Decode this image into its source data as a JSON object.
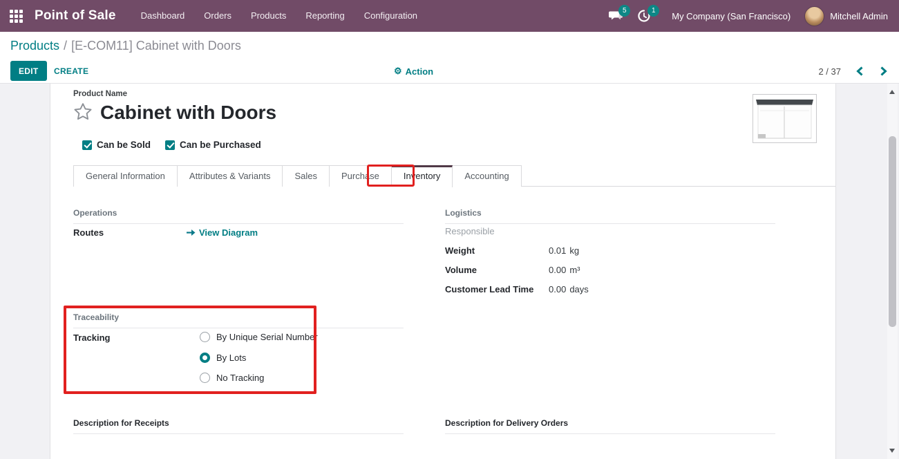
{
  "colors": {
    "navbar_bg": "#714B67",
    "accent_teal": "#017E84",
    "annotation_red": "#E1201F",
    "badge_teal": "#0D8786"
  },
  "navbar": {
    "app_name": "Point of Sale",
    "menus": [
      "Dashboard",
      "Orders",
      "Products",
      "Reporting",
      "Configuration"
    ],
    "messages_badge": "5",
    "activities_badge": "1",
    "company": "My Company (San Francisco)",
    "user": "Mitchell Admin"
  },
  "breadcrumb": {
    "parent": "Products",
    "separator": "/",
    "current": "[E-COM11] Cabinet with Doors"
  },
  "control_panel": {
    "edit": "EDIT",
    "create": "CREATE",
    "action": "Action",
    "pager": "2 / 37"
  },
  "product": {
    "name_label": "Product Name",
    "name": "Cabinet with Doors",
    "can_be_sold": "Can be Sold",
    "can_be_purchased": "Can be Purchased"
  },
  "tabs": {
    "items": [
      "General Information",
      "Attributes & Variants",
      "Sales",
      "Purchase",
      "Inventory",
      "Accounting"
    ],
    "active": "Inventory"
  },
  "operations": {
    "title": "Operations",
    "routes_label": "Routes",
    "view_diagram_label": "View Diagram"
  },
  "logistics": {
    "title": "Logistics",
    "responsible_label": "Responsible",
    "weight_label": "Weight",
    "weight_value": "0.01",
    "weight_unit": "kg",
    "volume_label": "Volume",
    "volume_value": "0.00",
    "volume_unit": "m³",
    "lead_time_label": "Customer Lead Time",
    "lead_time_value": "0.00",
    "lead_time_unit": "days"
  },
  "traceability": {
    "title": "Traceability",
    "tracking_label": "Tracking",
    "options": [
      {
        "label": "By Unique Serial Number",
        "selected": false
      },
      {
        "label": "By Lots",
        "selected": true
      },
      {
        "label": "No Tracking",
        "selected": false
      }
    ]
  },
  "descriptions": {
    "receipts": "Description for Receipts",
    "delivery": "Description for Delivery Orders"
  }
}
